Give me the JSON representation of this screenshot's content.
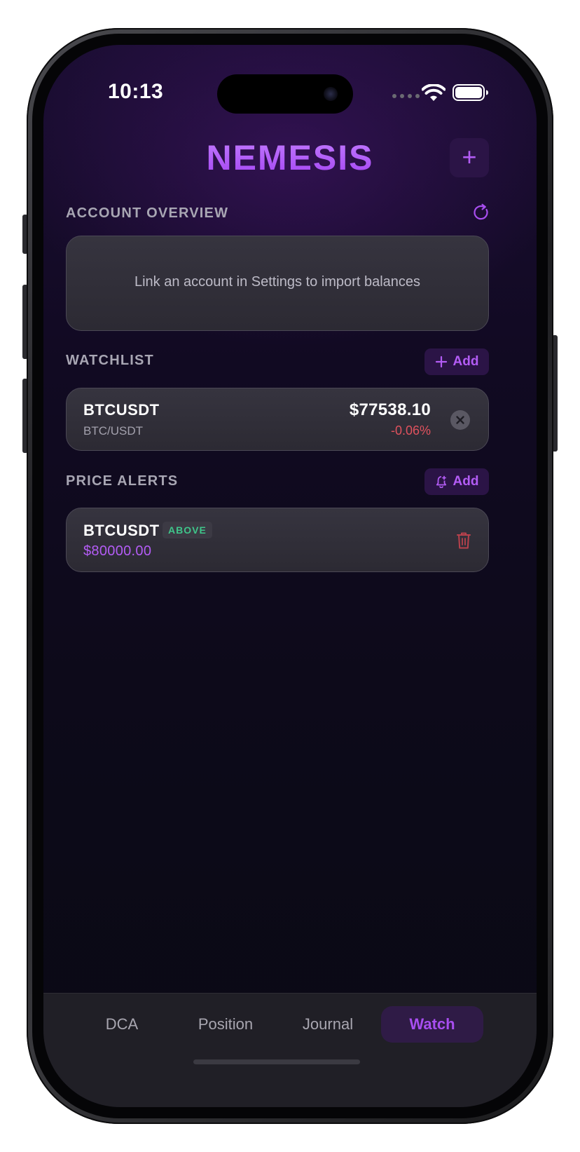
{
  "status_bar": {
    "time": "10:13"
  },
  "header": {
    "title": "NEMESIS",
    "add_button_label": "+"
  },
  "account_overview": {
    "label": "ACCOUNT OVERVIEW",
    "empty_message": "Link an account in Settings to import balances"
  },
  "watchlist": {
    "label": "WATCHLIST",
    "add_label": "Add",
    "items": [
      {
        "symbol": "BTCUSDT",
        "pair": "BTC/USDT",
        "price": "$77538.10",
        "change": "-0.06%"
      }
    ]
  },
  "price_alerts": {
    "label": "PRICE ALERTS",
    "add_label": "Add",
    "items": [
      {
        "symbol": "BTCUSDT",
        "direction": "ABOVE",
        "price": "$80000.00"
      }
    ]
  },
  "tabs": [
    {
      "label": "DCA",
      "active": false
    },
    {
      "label": "Position",
      "active": false
    },
    {
      "label": "Journal",
      "active": false
    },
    {
      "label": "Watch",
      "active": true
    }
  ],
  "colors": {
    "accent": "#b35cf5",
    "negative": "#e0525e",
    "positive_badge": "#3fc58a",
    "background": "#0d0a1a"
  }
}
